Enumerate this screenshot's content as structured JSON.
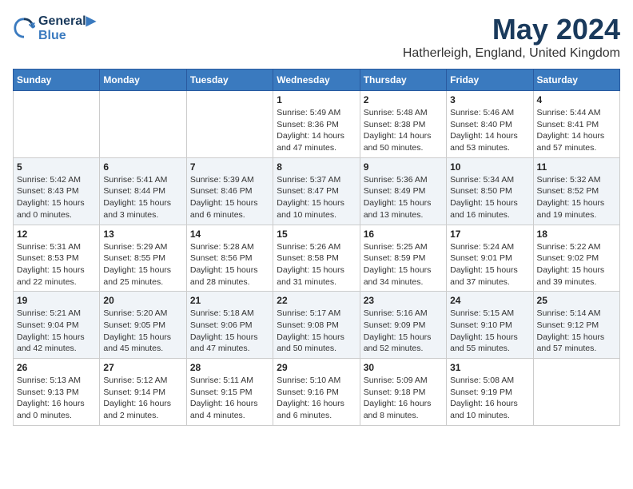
{
  "header": {
    "logo_line1": "General",
    "logo_line2": "Blue",
    "title": "May 2024",
    "subtitle": "Hatherleigh, England, United Kingdom"
  },
  "columns": [
    "Sunday",
    "Monday",
    "Tuesday",
    "Wednesday",
    "Thursday",
    "Friday",
    "Saturday"
  ],
  "weeks": [
    [
      {
        "day": "",
        "info": ""
      },
      {
        "day": "",
        "info": ""
      },
      {
        "day": "",
        "info": ""
      },
      {
        "day": "1",
        "info": "Sunrise: 5:49 AM\nSunset: 8:36 PM\nDaylight: 14 hours\nand 47 minutes."
      },
      {
        "day": "2",
        "info": "Sunrise: 5:48 AM\nSunset: 8:38 PM\nDaylight: 14 hours\nand 50 minutes."
      },
      {
        "day": "3",
        "info": "Sunrise: 5:46 AM\nSunset: 8:40 PM\nDaylight: 14 hours\nand 53 minutes."
      },
      {
        "day": "4",
        "info": "Sunrise: 5:44 AM\nSunset: 8:41 PM\nDaylight: 14 hours\nand 57 minutes."
      }
    ],
    [
      {
        "day": "5",
        "info": "Sunrise: 5:42 AM\nSunset: 8:43 PM\nDaylight: 15 hours\nand 0 minutes."
      },
      {
        "day": "6",
        "info": "Sunrise: 5:41 AM\nSunset: 8:44 PM\nDaylight: 15 hours\nand 3 minutes."
      },
      {
        "day": "7",
        "info": "Sunrise: 5:39 AM\nSunset: 8:46 PM\nDaylight: 15 hours\nand 6 minutes."
      },
      {
        "day": "8",
        "info": "Sunrise: 5:37 AM\nSunset: 8:47 PM\nDaylight: 15 hours\nand 10 minutes."
      },
      {
        "day": "9",
        "info": "Sunrise: 5:36 AM\nSunset: 8:49 PM\nDaylight: 15 hours\nand 13 minutes."
      },
      {
        "day": "10",
        "info": "Sunrise: 5:34 AM\nSunset: 8:50 PM\nDaylight: 15 hours\nand 16 minutes."
      },
      {
        "day": "11",
        "info": "Sunrise: 5:32 AM\nSunset: 8:52 PM\nDaylight: 15 hours\nand 19 minutes."
      }
    ],
    [
      {
        "day": "12",
        "info": "Sunrise: 5:31 AM\nSunset: 8:53 PM\nDaylight: 15 hours\nand 22 minutes."
      },
      {
        "day": "13",
        "info": "Sunrise: 5:29 AM\nSunset: 8:55 PM\nDaylight: 15 hours\nand 25 minutes."
      },
      {
        "day": "14",
        "info": "Sunrise: 5:28 AM\nSunset: 8:56 PM\nDaylight: 15 hours\nand 28 minutes."
      },
      {
        "day": "15",
        "info": "Sunrise: 5:26 AM\nSunset: 8:58 PM\nDaylight: 15 hours\nand 31 minutes."
      },
      {
        "day": "16",
        "info": "Sunrise: 5:25 AM\nSunset: 8:59 PM\nDaylight: 15 hours\nand 34 minutes."
      },
      {
        "day": "17",
        "info": "Sunrise: 5:24 AM\nSunset: 9:01 PM\nDaylight: 15 hours\nand 37 minutes."
      },
      {
        "day": "18",
        "info": "Sunrise: 5:22 AM\nSunset: 9:02 PM\nDaylight: 15 hours\nand 39 minutes."
      }
    ],
    [
      {
        "day": "19",
        "info": "Sunrise: 5:21 AM\nSunset: 9:04 PM\nDaylight: 15 hours\nand 42 minutes."
      },
      {
        "day": "20",
        "info": "Sunrise: 5:20 AM\nSunset: 9:05 PM\nDaylight: 15 hours\nand 45 minutes."
      },
      {
        "day": "21",
        "info": "Sunrise: 5:18 AM\nSunset: 9:06 PM\nDaylight: 15 hours\nand 47 minutes."
      },
      {
        "day": "22",
        "info": "Sunrise: 5:17 AM\nSunset: 9:08 PM\nDaylight: 15 hours\nand 50 minutes."
      },
      {
        "day": "23",
        "info": "Sunrise: 5:16 AM\nSunset: 9:09 PM\nDaylight: 15 hours\nand 52 minutes."
      },
      {
        "day": "24",
        "info": "Sunrise: 5:15 AM\nSunset: 9:10 PM\nDaylight: 15 hours\nand 55 minutes."
      },
      {
        "day": "25",
        "info": "Sunrise: 5:14 AM\nSunset: 9:12 PM\nDaylight: 15 hours\nand 57 minutes."
      }
    ],
    [
      {
        "day": "26",
        "info": "Sunrise: 5:13 AM\nSunset: 9:13 PM\nDaylight: 16 hours\nand 0 minutes."
      },
      {
        "day": "27",
        "info": "Sunrise: 5:12 AM\nSunset: 9:14 PM\nDaylight: 16 hours\nand 2 minutes."
      },
      {
        "day": "28",
        "info": "Sunrise: 5:11 AM\nSunset: 9:15 PM\nDaylight: 16 hours\nand 4 minutes."
      },
      {
        "day": "29",
        "info": "Sunrise: 5:10 AM\nSunset: 9:16 PM\nDaylight: 16 hours\nand 6 minutes."
      },
      {
        "day": "30",
        "info": "Sunrise: 5:09 AM\nSunset: 9:18 PM\nDaylight: 16 hours\nand 8 minutes."
      },
      {
        "day": "31",
        "info": "Sunrise: 5:08 AM\nSunset: 9:19 PM\nDaylight: 16 hours\nand 10 minutes."
      },
      {
        "day": "",
        "info": ""
      }
    ]
  ]
}
